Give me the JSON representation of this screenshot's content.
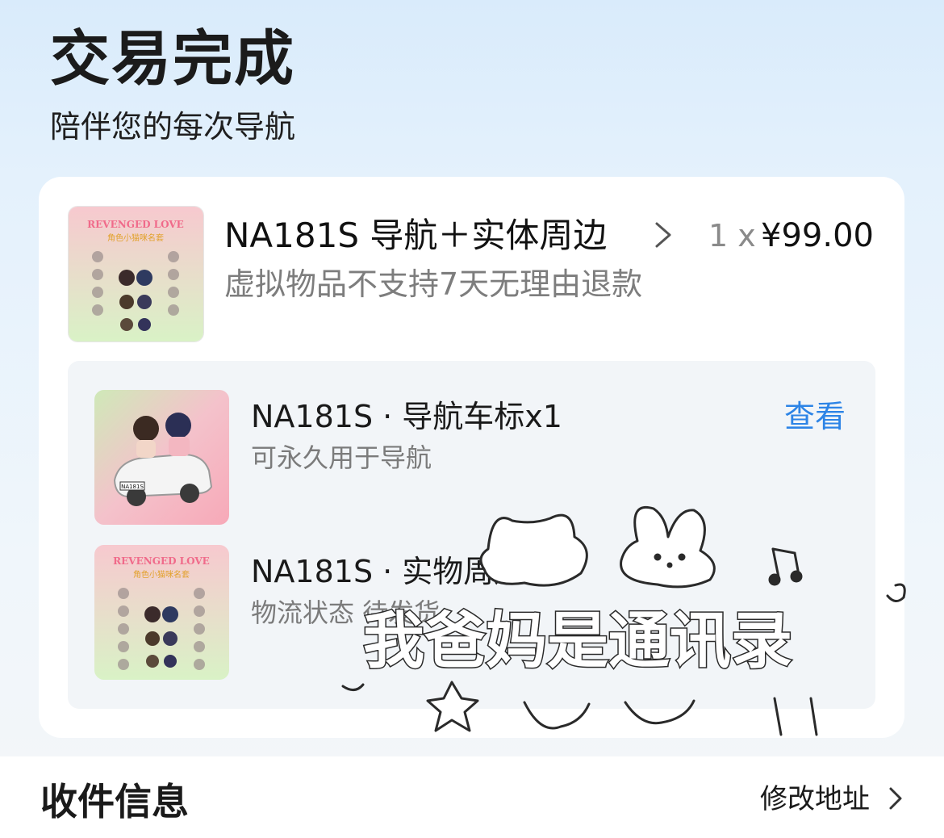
{
  "header": {
    "title": "交易完成",
    "subtitle": "陪伴您的每次导航"
  },
  "order": {
    "product": {
      "image_icon": "product-cover-image",
      "title": "NA181S 导航＋实体周边",
      "quantity": "1 x",
      "price": "¥99.00",
      "refund_note": "虚拟物品不支持7天无理由退款",
      "chevron_icon": "chevron-right-icon"
    },
    "items": [
      {
        "image_icon": "car-icon-image",
        "title": "NA181S · 导航车标x1",
        "description": "可永久用于导航",
        "action": "查看",
        "plate": "NA181S"
      },
      {
        "image_icon": "merch-image",
        "title": "NA181S · 实物周边x1",
        "description": "物流状态 待发货"
      }
    ],
    "cover_text": {
      "line1": "REVENGED LOVE",
      "line2": "角色小猫咪名套"
    }
  },
  "shipping": {
    "title": "收件信息",
    "edit_label": "修改地址",
    "chevron_icon": "chevron-right-icon"
  },
  "overlay": {
    "doodle_text": "我爸妈是通讯录"
  },
  "colors": {
    "link": "#2d84e6",
    "muted": "#7d7d7d",
    "panel": "#f2f5f8",
    "header_bg": "#d9ebfb"
  }
}
